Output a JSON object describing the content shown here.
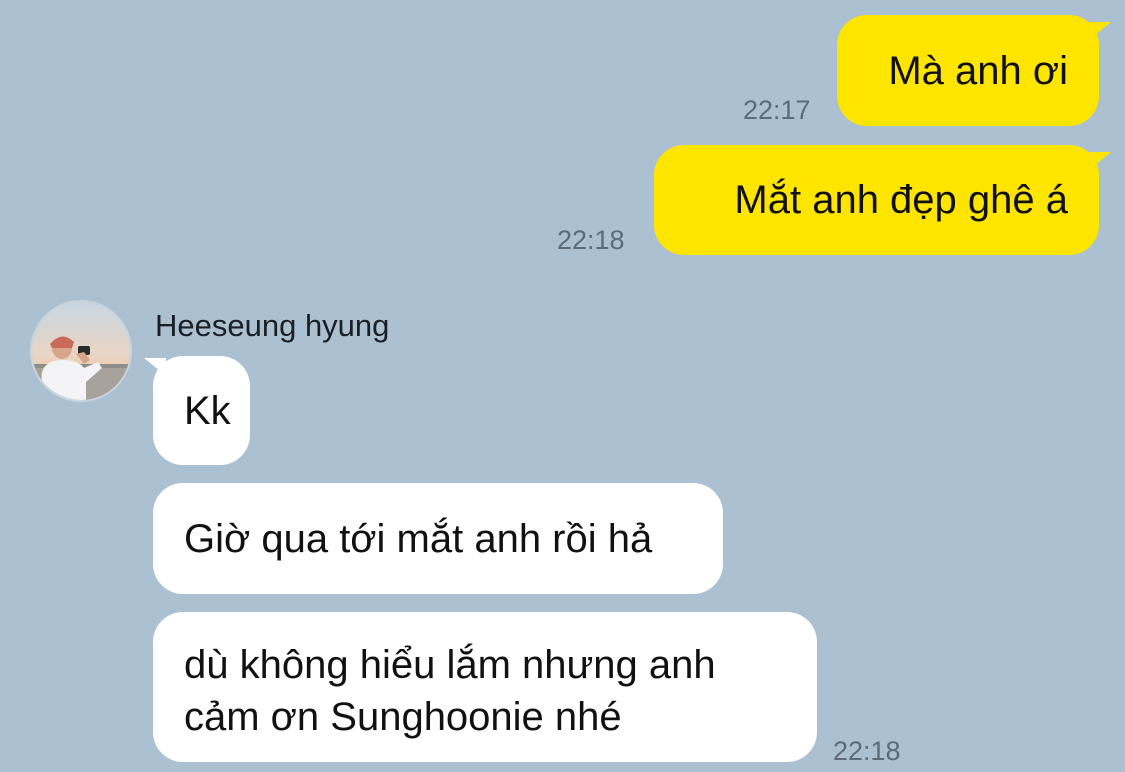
{
  "theme": {
    "background": "#abc1d1",
    "outgoing_bubble": "#fee500",
    "incoming_bubble": "#ffffff",
    "timestamp_color": "#5d6b77"
  },
  "messages_out": [
    {
      "text": "Mà anh ơi",
      "time": "22:17"
    },
    {
      "text": "Mắt anh đẹp ghê á",
      "time": "22:18"
    }
  ],
  "contact": {
    "name": "Heeseung hyung",
    "avatar_icon": "profile-photo-beach"
  },
  "messages_in": [
    {
      "text": "Kk"
    },
    {
      "text": "Giờ qua tới mắt anh rồi hả"
    },
    {
      "lines": [
        "dù không hiểu lắm nhưng anh",
        "cảm ơn Sunghoonie nhé"
      ],
      "time": "22:18"
    }
  ]
}
